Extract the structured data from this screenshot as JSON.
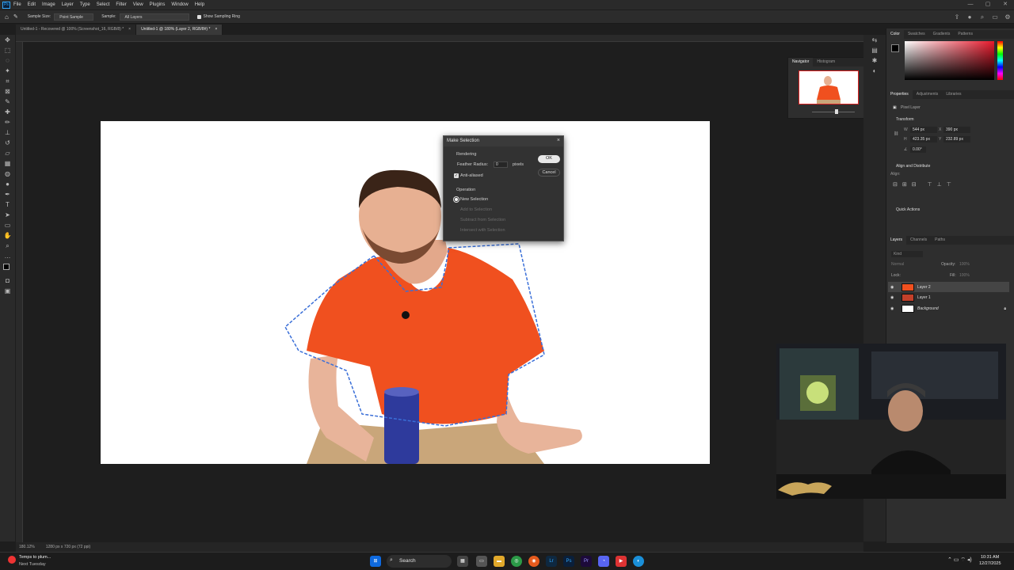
{
  "menubar": {
    "items": [
      "File",
      "Edit",
      "Image",
      "Layer",
      "Type",
      "Select",
      "Filter",
      "View",
      "Plugins",
      "Window",
      "Help"
    ]
  },
  "options_bar": {
    "sample_size_label": "Sample Size:",
    "sample_size_value": "Point Sample",
    "sample_label": "Sample:",
    "sample_value": "All Layers",
    "show_ring_label": "Show Sampling Ring"
  },
  "tabs": [
    {
      "label": "Untitled-1 - Recovered @ 100% (Screenshot_16, RGB/8) *",
      "active": false
    },
    {
      "label": "Untitled-1 @ 180% (Layer 2, RGB/8#) *",
      "active": true
    }
  ],
  "dialog": {
    "title": "Make Selection",
    "rendering_label": "Rendering",
    "feather_label": "Feather Radius:",
    "feather_value": "0",
    "feather_unit": "pixels",
    "antialias_label": "Anti-aliased",
    "ok_label": "OK",
    "cancel_label": "Cancel",
    "operation_label": "Operation",
    "op_new": "New Selection",
    "op_add": "Add to Selection",
    "op_subtract": "Subtract from Selection",
    "op_intersect": "Intersect with Selection"
  },
  "navigator": {
    "tab_navigator": "Navigator",
    "tab_histogram": "Histogram"
  },
  "color_panel": {
    "tabs": [
      "Color",
      "Swatches",
      "Gradients",
      "Patterns"
    ],
    "accent": "#e8192c"
  },
  "properties": {
    "tabs": [
      "Properties",
      "Adjustments",
      "Libraries"
    ],
    "layer_type": "Pixel Layer",
    "transform_label": "Transform",
    "w_label": "W",
    "w_value": "544 px",
    "x_label": "X",
    "x_value": "390 px",
    "h_label": "H",
    "h_value": "423.35 px",
    "y_label": "Y",
    "y_value": "232.89 px",
    "angle_value": "0.00°",
    "align_label": "Align and Distribute",
    "align_sub": "Align:",
    "quick_actions": "Quick Actions"
  },
  "layers": {
    "tabs": [
      "Layers",
      "Channels",
      "Paths"
    ],
    "kind_label": "Kind",
    "blend_mode": "Normal",
    "opacity_label": "Opacity:",
    "opacity_value": "100%",
    "lock_label": "Lock:",
    "fill_label": "Fill:",
    "fill_value": "100%",
    "items": [
      {
        "name": "Layer 2",
        "selected": true,
        "italic": false
      },
      {
        "name": "Layer 1",
        "selected": false,
        "italic": false
      },
      {
        "name": "Background",
        "selected": false,
        "italic": true
      }
    ]
  },
  "status": {
    "zoom": "180.12%",
    "doc_size": "1280 px x 720 px (72 ppi)"
  },
  "taskbar": {
    "weather_line1": "Temps to plum...",
    "weather_line2": "Next Tuesday",
    "search_label": "Search",
    "time": "10:31 AM",
    "date": "12/27/2025"
  }
}
